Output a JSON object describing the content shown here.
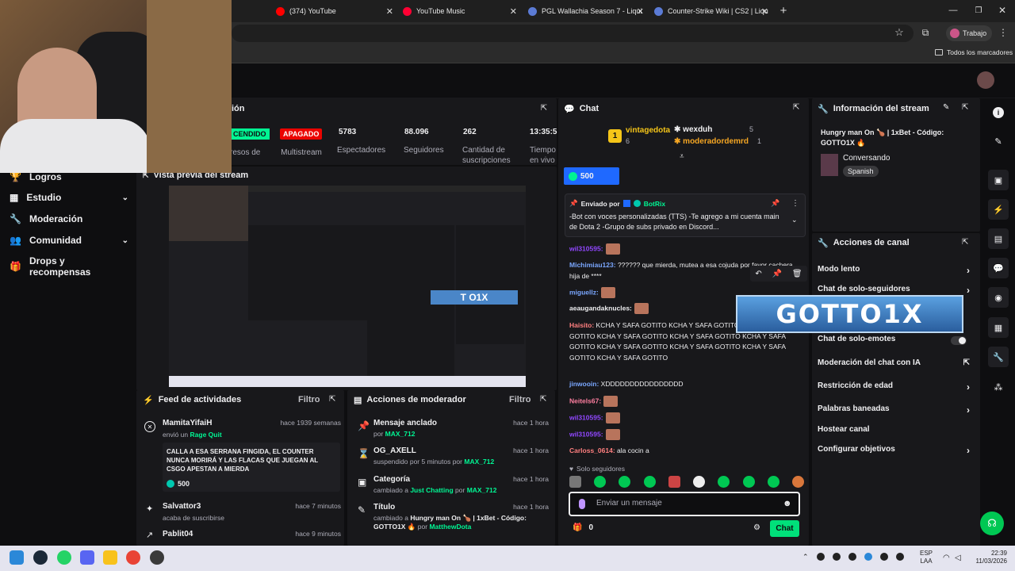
{
  "browser": {
    "tabs": [
      {
        "label": "(374) YouTube",
        "color": "#ff0000"
      },
      {
        "label": "YouTube Music",
        "color": "#ff0033"
      },
      {
        "label": "PGL Wallachia Season 7 - Liqui",
        "color": "#5b7bd5"
      },
      {
        "label": "Counter-Strike Wiki | CS2 | Liqu",
        "color": "#5b7bd5"
      }
    ],
    "profile": "Trabajo",
    "bookmarks_label": "Todos los marcadores"
  },
  "stats": {
    "title_fragment": "ión",
    "live_badge": "CENDIDO",
    "stopped_badge": "APAGADO",
    "multistream_label": "Multistream",
    "items": [
      {
        "value": "",
        "label": "resos de"
      },
      {
        "value": "5783",
        "label": "Espectadores"
      },
      {
        "value": "88.096",
        "label": "Seguidores"
      },
      {
        "value": "262",
        "label": "Cantidad de suscripciones"
      },
      {
        "value": "13:35:5",
        "label": "Tiempo en vivo"
      }
    ]
  },
  "nav": [
    {
      "label": "Logros",
      "icon": "trophy-icon",
      "chevron": false
    },
    {
      "label": "Estudio",
      "icon": "film-icon",
      "chevron": true
    },
    {
      "label": "Moderación",
      "icon": "wrench-icon",
      "chevron": false
    },
    {
      "label": "Comunidad",
      "icon": "people-icon",
      "chevron": true
    },
    {
      "label": "Drops y recompensas",
      "icon": "gift-icon",
      "chevron": false
    }
  ],
  "preview": {
    "title": "Vista previa del stream",
    "overlay_text": "T O1X"
  },
  "feed": {
    "title": "Feed de actividades",
    "filter": "Filtro",
    "items": [
      {
        "name": "MamitaYifaiH",
        "time": "hace 1939 semanas",
        "action_prefix": "envió un",
        "action_highlight": "Rage Quit",
        "message": "CALLA A ESA SERRANA FINGIDA, EL COUNTER NUNCA MORIRÁ Y LAS FLACAS QUE JUEGAN AL CSGO APESTAN A MIERDA",
        "amount": "500"
      },
      {
        "name": "Salvattor3",
        "time": "hace 7 minutos",
        "action_prefix": "acaba de suscribirse"
      },
      {
        "name": "Pablit04",
        "time": "hace 9 minutos"
      }
    ]
  },
  "modactions": {
    "title": "Acciones de moderador",
    "filter": "Filtro",
    "items": [
      {
        "title": "Mensaje anclado",
        "time": "hace 1 hora",
        "line_prefix": "por",
        "user": "MAX_712"
      },
      {
        "title": "OG_AXELL",
        "time": "hace 1 hora",
        "line_prefix": "suspendido por 5 minutos por",
        "user": "MAX_712"
      },
      {
        "title": "Categoría",
        "time": "hace 1 hora",
        "line_prefix": "cambiado a",
        "user": "Just Chatting",
        "line_mid": "por",
        "user2": "MAX_712"
      },
      {
        "title": "Título",
        "time": "hace 1 hora",
        "line_prefix": "cambiado a",
        "highlight": "Hungry man On 🍗 | 1xBet - Código: GOTTO1X 🔥",
        "line_mid": "por",
        "user2": "MatthewDota"
      }
    ]
  },
  "chat": {
    "title": "Chat",
    "leaders": [
      {
        "name": "vintagedota",
        "count": "6",
        "rank": "1"
      },
      {
        "name": "wexduh",
        "count": "5"
      },
      {
        "name": "moderadordemrd",
        "count": "1"
      }
    ],
    "points": "500",
    "pinned": {
      "sent_by": "Enviado por",
      "user": "BotRix",
      "text": "-Bot con voces personalizadas (TTS) -Te agrego a mi cuenta main de Dota 2 -Grupo de subs privado en Discord..."
    },
    "messages": [
      {
        "user": "wil310595:",
        "color": "#9147ff",
        "text": ""
      },
      {
        "user": "Michimiau123:",
        "color": "#7aa7ff",
        "text": "?????? que mierda, mutea a esa cojuda por favor cachera hija de ****"
      },
      {
        "user": "miguellz:",
        "color": "#7aa7ff",
        "text": ""
      },
      {
        "user": "aeaugandaknucles:",
        "color": "#efeff1",
        "text": ""
      },
      {
        "user": "Haisito:",
        "color": "#ff7f7f",
        "text": "KCHA Y SAFA GOTITO KCHA Y SAFA GOTITO KCHA Y SAFA GOTITO KCHA Y SAFA GOTITO KCHA Y SAFA GOTITO KCHA Y SAFA GOTITO KCHA Y SAFA GOTITO KCHA Y SAFA GOTITO KCHA Y SAFA GOTITO KCHA Y SAFA GOTITO"
      },
      {
        "user": "jinwooin:",
        "color": "#7aa7ff",
        "text": "XDDDDDDDDDDDDDDDD"
      },
      {
        "user": "Neitels67:",
        "color": "#ff7fa0",
        "text": ""
      },
      {
        "user": "wil310595:",
        "color": "#9147ff",
        "text": ""
      },
      {
        "user": "wil310595:",
        "color": "#9147ff",
        "text": ""
      },
      {
        "user": "Carloss_0614:",
        "color": "#ff7f7f",
        "text": "ala cocin a"
      }
    ],
    "followers_only": "Solo seguidores",
    "input_placeholder": "Enviar un mensaje",
    "points_count": "0",
    "send": "Chat"
  },
  "info": {
    "title": "Información del stream",
    "stream_title": "Hungry man On 🍗 | 1xBet - Código: GOTTO1X 🔥",
    "category": "Conversando",
    "language": "Spanish"
  },
  "actions": {
    "title": "Acciones de canal",
    "rows": [
      {
        "label": "Modo lento",
        "kind": "chevron"
      },
      {
        "label": "Chat de solo-seguidores",
        "kind": "chevron"
      },
      {
        "label": "Chat de solo-emotes",
        "kind": "toggle"
      },
      {
        "label": "Moderación del chat con IA",
        "kind": "external"
      },
      {
        "label": "Restricción de edad",
        "kind": "chevron"
      },
      {
        "label": "Palabras baneadas",
        "kind": "chevron"
      },
      {
        "label": "Hostear canal",
        "kind": "none"
      },
      {
        "label": "Configurar objetivos",
        "kind": "chevron"
      }
    ]
  },
  "overlay_logo": "GOTTO1X",
  "taskbar": {
    "lang": "ESP",
    "region": "LAA",
    "time": "22:39",
    "date": "11/03/2026"
  },
  "colors": {
    "accent": "#9147ff",
    "green": "#00f593",
    "red": "#eb0400",
    "twitch_bg": "#0e0e10",
    "panel": "#18181b"
  }
}
